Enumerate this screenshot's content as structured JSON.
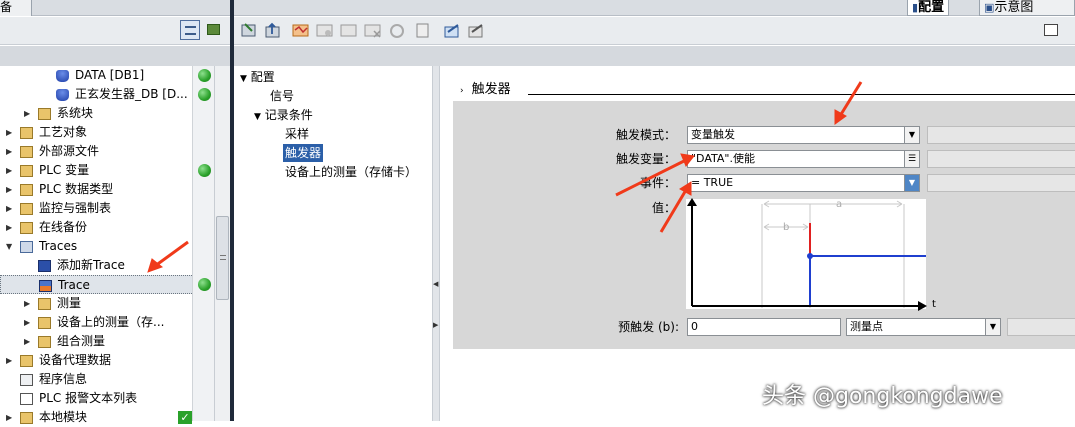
{
  "top": {
    "left_tab": "备",
    "right_tabs": [
      "配置",
      "示意图"
    ]
  },
  "tree": [
    {
      "label": "DATA [DB1]",
      "status": "green",
      "depth": 3,
      "twisty": "",
      "icon": "db-icon"
    },
    {
      "label": "正玄发生器_DB [D...",
      "status": "green",
      "depth": 3,
      "twisty": "",
      "icon": "db-icon"
    },
    {
      "label": "系统块",
      "status": "",
      "depth": 2,
      "twisty": "▶",
      "icon": "folder-icon"
    },
    {
      "label": "工艺对象",
      "status": "",
      "depth": 1,
      "twisty": "▶",
      "icon": "folder-icon"
    },
    {
      "label": "外部源文件",
      "status": "",
      "depth": 1,
      "twisty": "▶",
      "icon": "folder-icon"
    },
    {
      "label": "PLC 变量",
      "status": "green",
      "depth": 1,
      "twisty": "▶",
      "icon": "folder-icon"
    },
    {
      "label": "PLC 数据类型",
      "status": "",
      "depth": 1,
      "twisty": "▶",
      "icon": "folder-icon"
    },
    {
      "label": "监控与强制表",
      "status": "",
      "depth": 1,
      "twisty": "▶",
      "icon": "folder-icon"
    },
    {
      "label": "在线备份",
      "status": "",
      "depth": 1,
      "twisty": "▶",
      "icon": "folder-icon"
    },
    {
      "label": "Traces",
      "status": "",
      "depth": 1,
      "twisty": "▼",
      "icon": "trace-folder-icon"
    },
    {
      "label": "添加新Trace",
      "status": "",
      "depth": 2,
      "twisty": "",
      "icon": "add-trace-icon"
    },
    {
      "label": "Trace",
      "status": "green",
      "depth": 2,
      "twisty": "",
      "icon": "trace-icon",
      "selected": true
    },
    {
      "label": "测量",
      "status": "",
      "depth": 2,
      "twisty": "▶",
      "icon": "folder-icon"
    },
    {
      "label": "设备上的测量（存...",
      "status": "",
      "depth": 2,
      "twisty": "▶",
      "icon": "folder-icon"
    },
    {
      "label": "组合测量",
      "status": "",
      "depth": 2,
      "twisty": "▶",
      "icon": "folder-icon"
    },
    {
      "label": "设备代理数据",
      "status": "",
      "depth": 1,
      "twisty": "▶",
      "icon": "folder-icon"
    },
    {
      "label": "程序信息",
      "status": "",
      "depth": 1,
      "twisty": "",
      "icon": "info-icon"
    },
    {
      "label": "PLC 报警文本列表",
      "status": "",
      "depth": 1,
      "twisty": "",
      "icon": "list-icon"
    },
    {
      "label": "本地模块",
      "status": "check",
      "depth": 1,
      "twisty": "▶",
      "icon": "folder-icon"
    }
  ],
  "nav": {
    "root": "配置",
    "signal": "信号",
    "record": "记录条件",
    "sample": "采样",
    "trigger": "触发器",
    "storage": "设备上的测量（存储卡）"
  },
  "trigger": {
    "section_title": "触发器",
    "mode_label": "触发模式：",
    "mode_value": "变量触发",
    "var_label": "触发变量：",
    "var_value": "\"DATA\".使能",
    "event_label": "事件：",
    "event_value": "= TRUE",
    "value_label": "值：",
    "pretrigger_label": "预触发 (b):",
    "pretrigger_value": "0",
    "pretrigger_unit": "测量点"
  },
  "diagram": {
    "label_a": "a",
    "label_b": "b",
    "label_t": "t"
  },
  "watermark": "头条 @gongkongdawe",
  "colors": {
    "signal": "#1f3fcf",
    "trigger_edge": "#e02020",
    "arrow": "#f03a1a"
  }
}
